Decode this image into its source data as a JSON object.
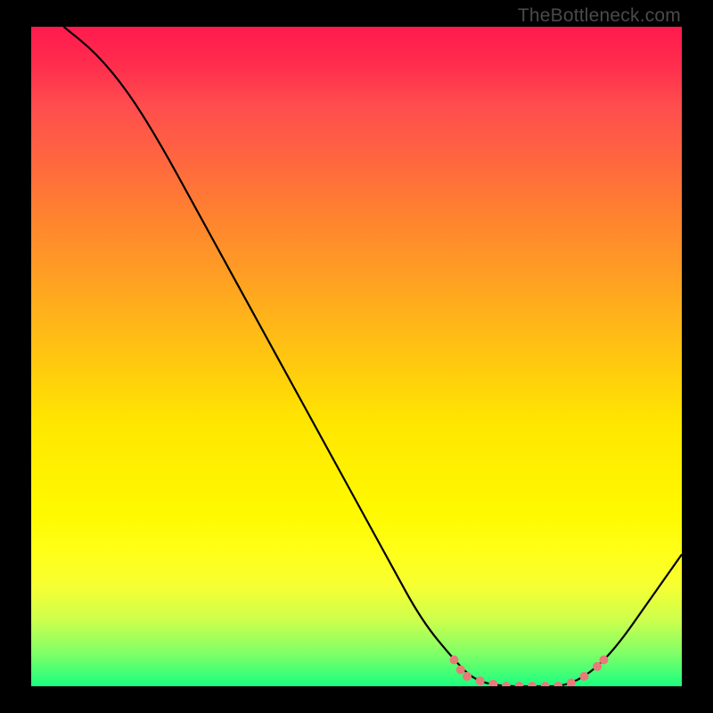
{
  "watermark": "TheBottleneck.com",
  "chart_data": {
    "type": "line",
    "title": "",
    "xlabel": "",
    "ylabel": "",
    "xlim": [
      0,
      100
    ],
    "ylim": [
      0,
      100
    ],
    "series": [
      {
        "name": "curve",
        "points": [
          {
            "x": 5,
            "y": 100
          },
          {
            "x": 10,
            "y": 96
          },
          {
            "x": 15,
            "y": 90
          },
          {
            "x": 20,
            "y": 82
          },
          {
            "x": 25,
            "y": 73
          },
          {
            "x": 30,
            "y": 64
          },
          {
            "x": 35,
            "y": 55
          },
          {
            "x": 40,
            "y": 46
          },
          {
            "x": 45,
            "y": 37
          },
          {
            "x": 50,
            "y": 28
          },
          {
            "x": 55,
            "y": 19
          },
          {
            "x": 60,
            "y": 10
          },
          {
            "x": 65,
            "y": 4
          },
          {
            "x": 68,
            "y": 1
          },
          {
            "x": 72,
            "y": 0
          },
          {
            "x": 78,
            "y": 0
          },
          {
            "x": 82,
            "y": 0
          },
          {
            "x": 86,
            "y": 2
          },
          {
            "x": 90,
            "y": 6
          },
          {
            "x": 95,
            "y": 13
          },
          {
            "x": 100,
            "y": 20
          }
        ]
      },
      {
        "name": "highlight-dots",
        "color": "#e87a7a",
        "points": [
          {
            "x": 65,
            "y": 4
          },
          {
            "x": 66,
            "y": 2.5
          },
          {
            "x": 67,
            "y": 1.5
          },
          {
            "x": 69,
            "y": 0.8
          },
          {
            "x": 71,
            "y": 0.3
          },
          {
            "x": 73,
            "y": 0
          },
          {
            "x": 75,
            "y": 0
          },
          {
            "x": 77,
            "y": 0
          },
          {
            "x": 79,
            "y": 0
          },
          {
            "x": 81,
            "y": 0
          },
          {
            "x": 83,
            "y": 0.5
          },
          {
            "x": 85,
            "y": 1.5
          },
          {
            "x": 87,
            "y": 3
          },
          {
            "x": 88,
            "y": 4
          }
        ]
      }
    ],
    "gradient_stops": [
      {
        "pos": 0,
        "color": "#ff1a4d"
      },
      {
        "pos": 50,
        "color": "#ffcc0d"
      },
      {
        "pos": 100,
        "color": "#1aff80"
      }
    ]
  }
}
